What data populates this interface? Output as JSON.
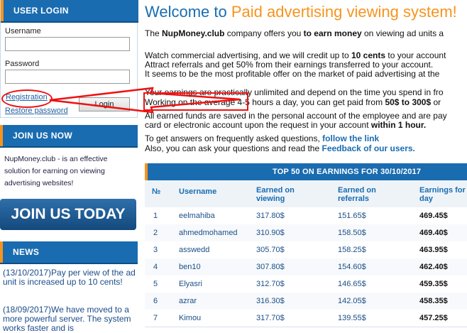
{
  "login": {
    "title": "USER LOGIN",
    "username_label": "Username",
    "password_label": "Password",
    "username_value": "",
    "password_value": "",
    "registration_link": "Registration",
    "restore_link": "Restore password",
    "login_button": "Login"
  },
  "join": {
    "title": "JOIN US NOW",
    "text": "NupMoney.club - is an effective solution for earning on viewing advertising websites!",
    "button": "JOIN US TODAY"
  },
  "news": {
    "title": "NEWS",
    "items": [
      "(13/10/2017)Pay per view of the ad unit is increased up to 10 cents!",
      "(18/09/2017)We have moved to a more powerful server. The system works faster and is"
    ]
  },
  "main": {
    "title_prefix": "Welcome to ",
    "title_highlight": "Paid advertising viewing system!",
    "intro_a": "The ",
    "intro_brand": "NupMoney.club",
    "intro_b": " company offers you ",
    "intro_earn": "to earn money",
    "intro_c": " on viewing ad units a",
    "p2_l1a": "Watch commercial advertising, and we will credit up to ",
    "p2_l1b": "10 cents",
    "p2_l1c": " to your account",
    "p2_l2": "Attract referrals and get 50% from their earnings transferred to your account.",
    "p2_l3": "It seems to be the most profitable offer on the market of paid advertising at the",
    "p3_l1": "Your earnings are practically unlimited and depend on the time you spend in fro",
    "p3_l2a": "Working on the average ",
    "p3_l2b": "4-5 hours a day, you can get paid from ",
    "p3_l2c": "50$ to 300$",
    "p3_l2d": " or",
    "p4_l1": "All earned funds are saved in the personal account of the employee and are pay",
    "p4_l2a": "card or electronic account upon the request in your account ",
    "p4_l2b": "within 1 hour.",
    "p5_l1a": "To get answers on frequently asked questions, ",
    "p5_l1b": "follow the link",
    "p5_l2a": "Also, you can ask your questions and read the ",
    "p5_l2b": "Feedback of our users."
  },
  "top": {
    "title": "TOP 50 ON EARNINGS FOR 30/10/2017",
    "columns": [
      "№",
      "Username",
      "Earned on viewing",
      "Earned on referrals",
      "Earnings for day"
    ],
    "rows": [
      [
        "1",
        "eelmahiba",
        "317.80$",
        "151.65$",
        "469.45$"
      ],
      [
        "2",
        "ahmedmohamed",
        "310.90$",
        "158.50$",
        "469.40$"
      ],
      [
        "3",
        "asswedd",
        "305.70$",
        "158.25$",
        "463.95$"
      ],
      [
        "4",
        "ben10",
        "307.80$",
        "154.60$",
        "462.40$"
      ],
      [
        "5",
        "Elyasri",
        "312.70$",
        "146.65$",
        "459.35$"
      ],
      [
        "6",
        "azrar",
        "316.30$",
        "142.05$",
        "458.35$"
      ],
      [
        "7",
        "Kimou",
        "317.70$",
        "139.55$",
        "457.25$"
      ]
    ]
  },
  "colors": {
    "brand_blue": "#1a6cb0",
    "accent_orange": "#f7941d",
    "annotation_red": "#e11111"
  }
}
